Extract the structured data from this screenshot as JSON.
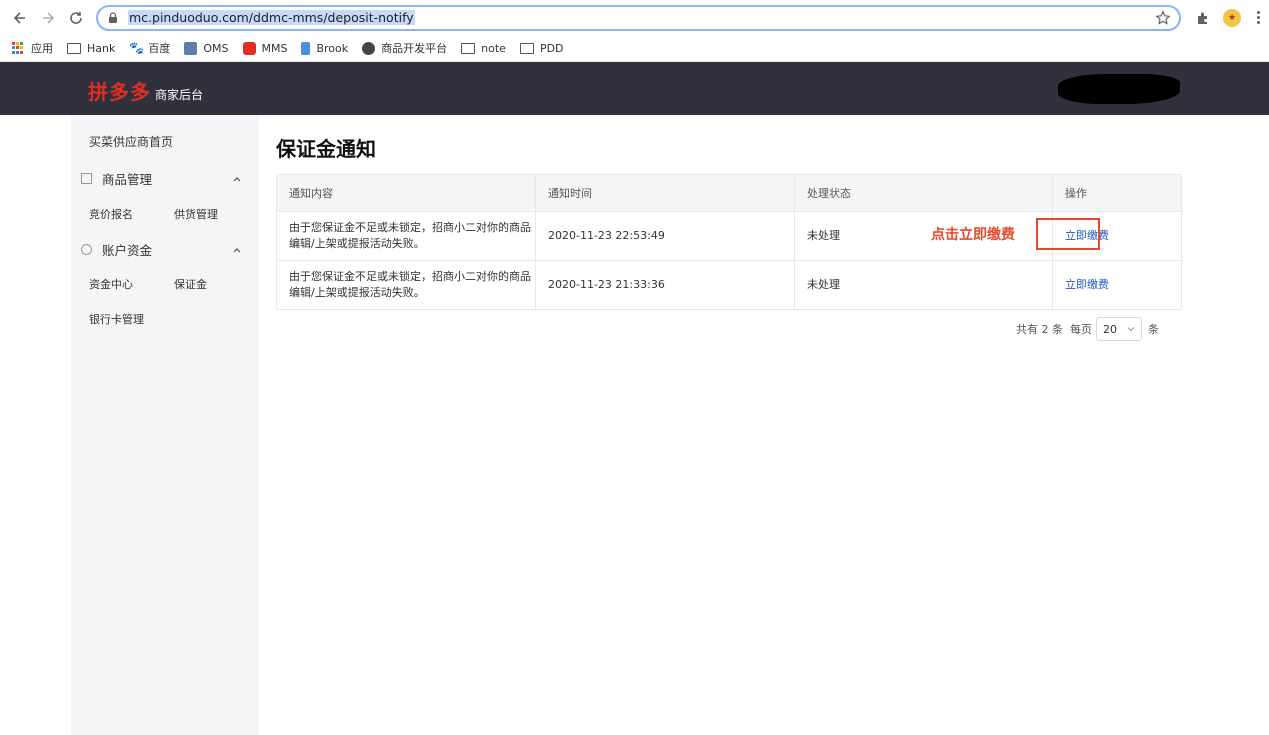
{
  "browser": {
    "url": "mc.pinduoduo.com/ddmc-mms/deposit-notify",
    "bookmarks": [
      {
        "label": "应用",
        "icon": "apps-grid-icon"
      },
      {
        "label": "Hank",
        "icon": "folder-icon"
      },
      {
        "label": "百度",
        "icon": "baidu-icon"
      },
      {
        "label": "OMS",
        "icon": "oms-icon"
      },
      {
        "label": "MMS",
        "icon": "mms-icon"
      },
      {
        "label": "Brook",
        "icon": "brook-icon"
      },
      {
        "label": "商品开发平台",
        "icon": "globe-icon"
      },
      {
        "label": "note",
        "icon": "folder-icon"
      },
      {
        "label": "PDD",
        "icon": "folder-icon"
      }
    ]
  },
  "header": {
    "logo": "拼多多",
    "subtitle": "商家后台"
  },
  "sidebar": {
    "home": "买菜供应商首页",
    "groups": [
      {
        "label": "商品管理",
        "icon": "product-icon",
        "items": [
          "竞价报名",
          "供货管理"
        ]
      },
      {
        "label": "账户资金",
        "icon": "yen-icon",
        "items": [
          "资金中心",
          "保证金",
          "银行卡管理"
        ]
      }
    ]
  },
  "main": {
    "title": "保证金通知",
    "columns": [
      "通知内容",
      "通知时间",
      "处理状态",
      "操作"
    ],
    "rows": [
      {
        "content": "由于您保证金不足或未锁定，招商小二对你的商品编辑/上架或提报活动失败。",
        "time": "2020-11-23 22:53:49",
        "status": "未处理",
        "action": "立即缴费"
      },
      {
        "content": "由于您保证金不足或未锁定，招商小二对你的商品编辑/上架或提报活动失败。",
        "time": "2020-11-23 21:33:36",
        "status": "未处理",
        "action": "立即缴费"
      }
    ],
    "annotation": "点击立即缴费",
    "pager": {
      "total_prefix": "共有",
      "total": "2",
      "total_suffix": "条",
      "per_page_label": "每页",
      "per_page": "20",
      "per_page_suffix": "条"
    }
  },
  "colors": {
    "header_bg": "#30313c",
    "logo": "#e02e24",
    "link": "#1f5bbd",
    "annotation": "#e64a2e"
  }
}
